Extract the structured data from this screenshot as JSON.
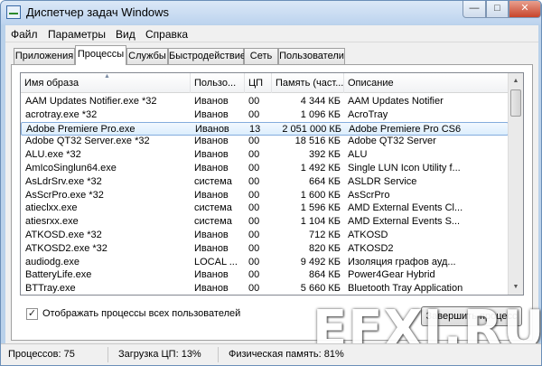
{
  "window": {
    "title": "Диспетчер задач Windows",
    "minimize_glyph": "—",
    "maximize_glyph": "□",
    "close_glyph": "✕"
  },
  "menu": [
    "Файл",
    "Параметры",
    "Вид",
    "Справка"
  ],
  "tabs": [
    "Приложения",
    "Процессы",
    "Службы",
    "Быстродействие",
    "Сеть",
    "Пользователи"
  ],
  "active_tab": "Процессы",
  "columns": {
    "image_name": "Имя образа",
    "user": "Пользо...",
    "cpu": "ЦП",
    "memory": "Память (част...",
    "description": "Описание"
  },
  "processes": [
    {
      "name": "AAM Updates Notifier.exe *32",
      "user": "Иванов",
      "cpu": "00",
      "mem": "4 344 КБ",
      "desc": "AAM Updates Notifier"
    },
    {
      "name": "acrotray.exe *32",
      "user": "Иванов",
      "cpu": "00",
      "mem": "1 096 КБ",
      "desc": "AcroTray"
    },
    {
      "name": "Adobe Premiere Pro.exe",
      "user": "Иванов",
      "cpu": "13",
      "mem": "2 051 000 КБ",
      "desc": "Adobe Premiere Pro CS6"
    },
    {
      "name": "Adobe QT32 Server.exe *32",
      "user": "Иванов",
      "cpu": "00",
      "mem": "18 516 КБ",
      "desc": "Adobe QT32 Server"
    },
    {
      "name": "ALU.exe *32",
      "user": "Иванов",
      "cpu": "00",
      "mem": "392 КБ",
      "desc": "ALU"
    },
    {
      "name": "AmIcoSinglun64.exe",
      "user": "Иванов",
      "cpu": "00",
      "mem": "1 492 КБ",
      "desc": "Single LUN Icon Utility f..."
    },
    {
      "name": "AsLdrSrv.exe *32",
      "user": "система",
      "cpu": "00",
      "mem": "664 КБ",
      "desc": "ASLDR Service"
    },
    {
      "name": "AsScrPro.exe *32",
      "user": "Иванов",
      "cpu": "00",
      "mem": "1 600 КБ",
      "desc": "AsScrPro"
    },
    {
      "name": "atieclxx.exe",
      "user": "система",
      "cpu": "00",
      "mem": "1 596 КБ",
      "desc": "AMD External Events Cl..."
    },
    {
      "name": "atiesrxx.exe",
      "user": "система",
      "cpu": "00",
      "mem": "1 104 КБ",
      "desc": "AMD External Events S..."
    },
    {
      "name": "ATKOSD.exe *32",
      "user": "Иванов",
      "cpu": "00",
      "mem": "712 КБ",
      "desc": "ATKOSD"
    },
    {
      "name": "ATKOSD2.exe *32",
      "user": "Иванов",
      "cpu": "00",
      "mem": "820 КБ",
      "desc": "ATKOSD2"
    },
    {
      "name": "audiodg.exe",
      "user": "LOCAL ...",
      "cpu": "00",
      "mem": "9 492 КБ",
      "desc": "Изоляция графов ауд..."
    },
    {
      "name": "BatteryLife.exe",
      "user": "Иванов",
      "cpu": "00",
      "mem": "864 КБ",
      "desc": "Power4Gear Hybrid"
    },
    {
      "name": "BTTray.exe",
      "user": "Иванов",
      "cpu": "00",
      "mem": "5 660 КБ",
      "desc": "Bluetooth Tray Application"
    }
  ],
  "selected_row_index": 2,
  "show_all_users": {
    "label": "Отображать процессы всех пользователей",
    "checked": true,
    "glyph": "✓"
  },
  "end_process_button": "Завершить процесс",
  "watermark": "EFXI.RU",
  "status": {
    "processes": "Процессов: 75",
    "cpu": "Загрузка ЦП: 13%",
    "memory": "Физическая память: 81%"
  },
  "scrollbar": {
    "up_glyph": "▲",
    "down_glyph": "▼"
  },
  "sort_glyph": "▲"
}
